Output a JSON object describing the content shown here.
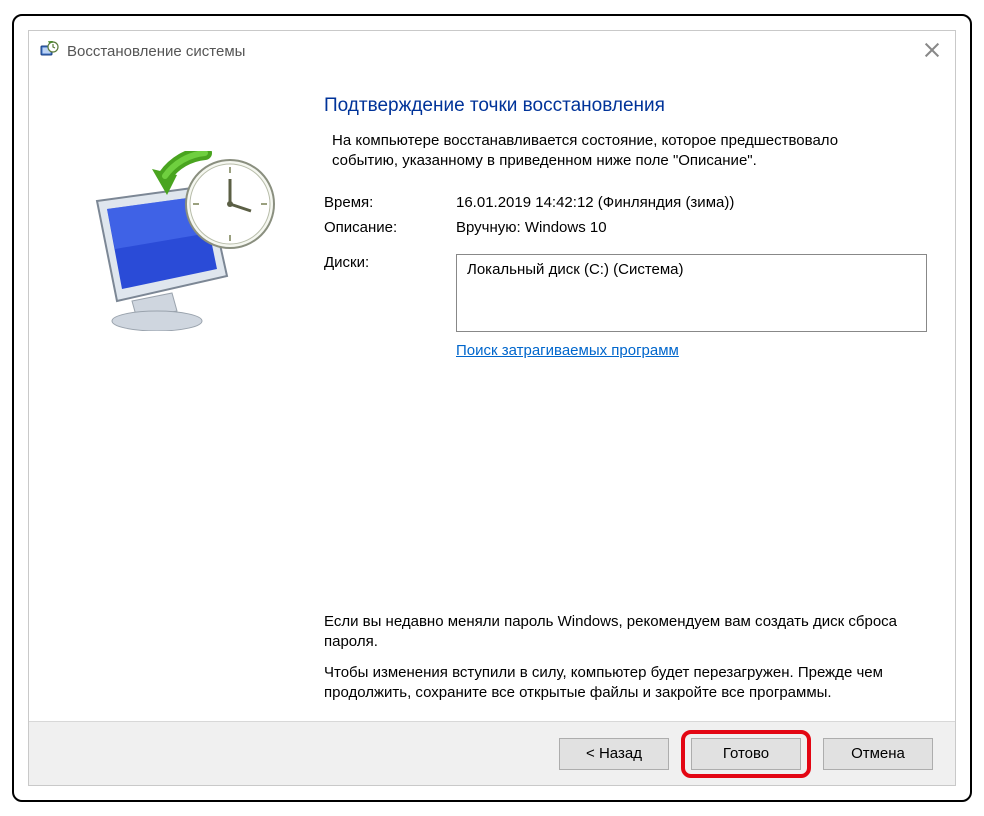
{
  "window": {
    "title": "Восстановление системы"
  },
  "main": {
    "heading": "Подтверждение точки восстановления",
    "intro": "На компьютере восстанавливается состояние, которое предшествовало событию, указанному в приведенном ниже поле \"Описание\".",
    "time_label": "Время:",
    "time_value": "16.01.2019 14:42:12 (Финляндия (зима))",
    "desc_label": "Описание:",
    "desc_value": "Вручную: Windows 10",
    "disks_label": "Диски:",
    "disks_value": "Локальный диск (C:) (Система)",
    "scan_link": "Поиск затрагиваемых программ",
    "note1": "Если вы недавно меняли пароль Windows, рекомендуем вам создать диск сброса пароля.",
    "note2": "Чтобы изменения вступили в силу, компьютер будет перезагружен. Прежде чем продолжить, сохраните все открытые файлы и закройте все программы."
  },
  "footer": {
    "back": "< Назад",
    "finish": "Готово",
    "cancel": "Отмена"
  }
}
